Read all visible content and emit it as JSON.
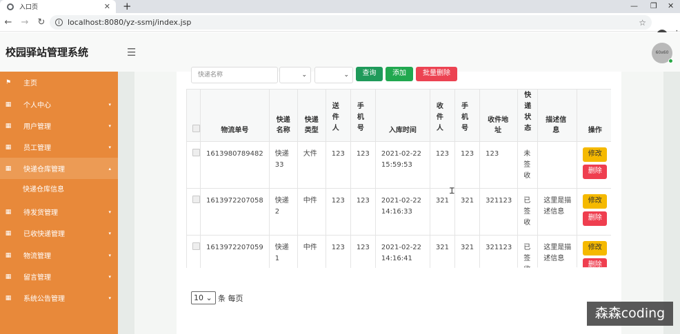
{
  "browser": {
    "tab_title": "入口页",
    "tab_close": "✕",
    "new_tab": "+",
    "url": "localhost:8080/yz-ssmj/index.jsp",
    "win_min": "—",
    "win_max": "❐",
    "win_close": "✕"
  },
  "header": {
    "brand": "校园驿站管理系统",
    "avatar_text": "60x60"
  },
  "sidebar": {
    "items": [
      {
        "label": "主页",
        "icon": "flag-icon"
      },
      {
        "label": "个人中心",
        "icon": "grid-icon"
      },
      {
        "label": "用户管理",
        "icon": "grid-icon"
      },
      {
        "label": "员工管理",
        "icon": "grid-icon"
      },
      {
        "label": "快递仓库管理",
        "icon": "grid-icon"
      },
      {
        "label": "待发货管理",
        "icon": "grid-icon"
      },
      {
        "label": "已收快递管理",
        "icon": "grid-icon"
      },
      {
        "label": "物流管理",
        "icon": "grid-icon"
      },
      {
        "label": "留言管理",
        "icon": "grid-icon"
      },
      {
        "label": "系统公告管理",
        "icon": "grid-icon"
      }
    ],
    "sub_item": "快递仓库信息",
    "colors": {
      "bg": "#e8893a",
      "active": "#ec9b55"
    }
  },
  "filter": {
    "placeholder": "快递名称",
    "query_btn": "查询",
    "add_btn": "添加",
    "batch_delete_btn": "批量删除"
  },
  "table": {
    "headers": [
      "物流单号",
      "快递名称",
      "快递类型",
      "送件人",
      "手机号",
      "入库时间",
      "收件人",
      "手机号",
      "收件地址",
      "快递状态",
      "描述信息",
      "操作"
    ],
    "rows": [
      {
        "id": "1613980789482",
        "name": "快递33",
        "type": "大件",
        "sender": "123",
        "phone": "123",
        "time": "2021-02-22 15:59:53",
        "receiver": "123",
        "rphone": "123",
        "addr": "123",
        "status": "未签收",
        "desc": ""
      },
      {
        "id": "1613972207058",
        "name": "快递2",
        "type": "中件",
        "sender": "123",
        "phone": "123",
        "time": "2021-02-22 14:16:33",
        "receiver": "321",
        "rphone": "321",
        "addr": "321123",
        "status": "已签收",
        "desc": "这里是描述信息"
      },
      {
        "id": "1613972207059",
        "name": "快递1",
        "type": "中件",
        "sender": "123",
        "phone": "123",
        "time": "2021-02-22 14:16:41",
        "receiver": "321",
        "rphone": "321",
        "addr": "321123",
        "status": "已签收",
        "desc": "这里是描述信息"
      }
    ],
    "edit_label": "修改",
    "delete_label": "删除"
  },
  "pager": {
    "page_size": "10",
    "suffix": "条 每页"
  },
  "watermark": "森森coding"
}
